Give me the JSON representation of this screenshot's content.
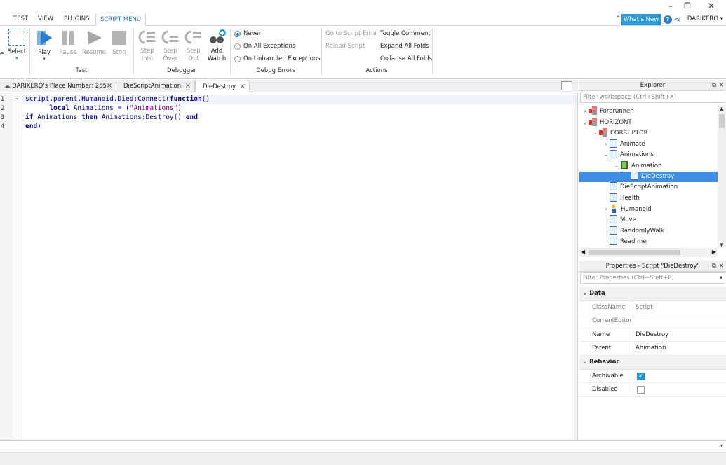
{
  "ribbon_tabs": [
    "TEST",
    "VIEW",
    "PLUGINS",
    "SCRIPT MENU"
  ],
  "active_tab": "SCRIPT MENU",
  "top_right": {
    "whats_new": "What's New",
    "help": "?",
    "user": "DARIKERO"
  },
  "ribbon": {
    "test_group": {
      "label": "Test",
      "select": "Select",
      "play": "Play",
      "pause": "Pause",
      "resume": "Resume",
      "stop": "Stop"
    },
    "debugger_group": {
      "label": "Debugger",
      "step_into": [
        "Step",
        "Into"
      ],
      "step_over": [
        "Step",
        "Over"
      ],
      "step_out": [
        "Step",
        "Out"
      ],
      "add_watch": [
        "Add",
        "Watch"
      ]
    },
    "debug_errors_group": {
      "label": "Debug Errors",
      "options": [
        "Never",
        "On All Exceptions",
        "On Unhandled Exceptions"
      ],
      "selected": "Never"
    },
    "actions_group": {
      "label": "Actions",
      "go_to_script_error": "Go to Script Error",
      "reload_script": "Reload Script",
      "toggle_comment": "Toggle Comment",
      "expand_all_folds": "Expand All Folds",
      "collapse_all_folds": "Collapse All Folds"
    }
  },
  "doc_tabs": [
    {
      "label": "DARIKERO's Place Number: 255",
      "active": false
    },
    {
      "label": "DieScriptAnimation",
      "active": false
    },
    {
      "label": "DieDestroy",
      "active": true
    }
  ],
  "editor": {
    "line_numbers": [
      "1",
      "2",
      "3",
      "4"
    ],
    "lines": [
      "script.parent.Humanoid.Died:Connect(function()",
      "      local Animations = (\"Animations\")",
      "if Animations then Animations:Destroy() end",
      "end)"
    ]
  },
  "explorer": {
    "title": "Explorer",
    "filter_placeholder": "Filter workspace (Ctrl+Shift+X)",
    "items": [
      {
        "label": "Forerunner",
        "icon": "model-icon",
        "chevron": "collapsed"
      },
      {
        "label": "HORIZONT",
        "icon": "model-icon",
        "chevron": "expanded"
      },
      {
        "label": "CORRUPTOR",
        "icon": "model-icon",
        "chevron": "expanded"
      },
      {
        "label": "Animate",
        "icon": "script-icon",
        "chevron": "collapsed"
      },
      {
        "label": "Animations",
        "icon": "script-icon",
        "chevron": "expanded"
      },
      {
        "label": "Animation",
        "icon": "animation-icon",
        "chevron": "expanded"
      },
      {
        "label": "DieDestroy",
        "icon": "script-icon",
        "chevron": "none",
        "selected": true
      },
      {
        "label": "DieScriptAnimation",
        "icon": "script-icon",
        "chevron": "none"
      },
      {
        "label": "Health",
        "icon": "script-icon",
        "chevron": "none"
      },
      {
        "label": "Humanoid",
        "icon": "humanoid-icon",
        "chevron": "collapsed"
      },
      {
        "label": "Move",
        "icon": "script-icon",
        "chevron": "none"
      },
      {
        "label": "RandomlyWalk",
        "icon": "script-icon",
        "chevron": "none"
      },
      {
        "label": "Read me",
        "icon": "script-icon",
        "chevron": "none"
      }
    ]
  },
  "properties": {
    "title": "Properties - Script \"DieDestroy\"",
    "filter_placeholder": "Filter Properties (Ctrl+Shift+P)",
    "categories": [
      {
        "name": "Data",
        "rows": [
          {
            "name": "ClassName",
            "value": "Script"
          },
          {
            "name": "CurrentEditor",
            "value": ""
          },
          {
            "name": "Name",
            "value": "DieDestroy"
          },
          {
            "name": "Parent",
            "value": "Animation"
          }
        ]
      },
      {
        "name": "Behavior",
        "rows": [
          {
            "name": "Archivable",
            "checked": true
          },
          {
            "name": "Disabled",
            "checked": false
          }
        ]
      }
    ]
  },
  "colors": {
    "accent": "#2b79c2",
    "whats_new_bg": "#2a9bd8",
    "selection": "#3d8ee4",
    "code_keyword": "#00008b",
    "code_string": "#800080"
  }
}
